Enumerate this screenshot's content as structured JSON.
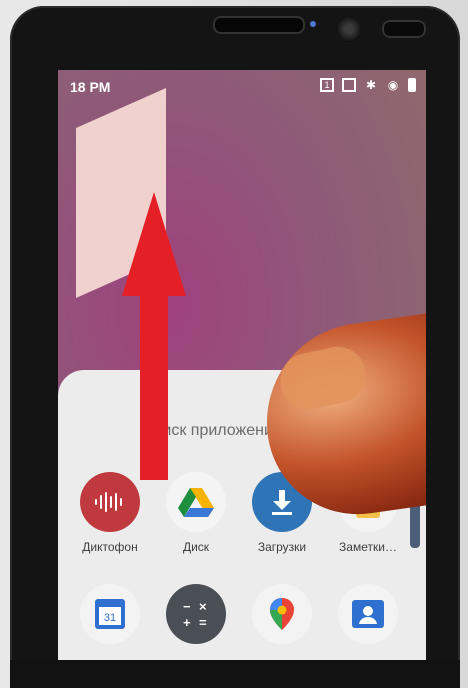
{
  "status_bar": {
    "time": "18 PM"
  },
  "drawer": {
    "search_label": "Поиск приложений",
    "apps_row1": [
      {
        "name": "Диктофон",
        "icon": "voice-recorder-icon",
        "color": "#c0393f"
      },
      {
        "name": "Диск",
        "icon": "google-drive-icon",
        "color": "#f4f4f4"
      },
      {
        "name": "Загрузки",
        "icon": "download-icon",
        "color": "#2f74b6"
      },
      {
        "name": "Заметки…",
        "icon": "notes-icon",
        "color": "#f3c96a"
      }
    ],
    "apps_row2": [
      {
        "name": "calendar",
        "icon": "calendar-icon",
        "badge": "31"
      },
      {
        "name": "calculator",
        "icon": "calculator-icon"
      },
      {
        "name": "maps",
        "icon": "maps-pin-icon"
      },
      {
        "name": "contacts",
        "icon": "contacts-icon"
      }
    ]
  },
  "colors": {
    "arrow": "#e41f26",
    "wallpaper": "#9a4a7a"
  }
}
